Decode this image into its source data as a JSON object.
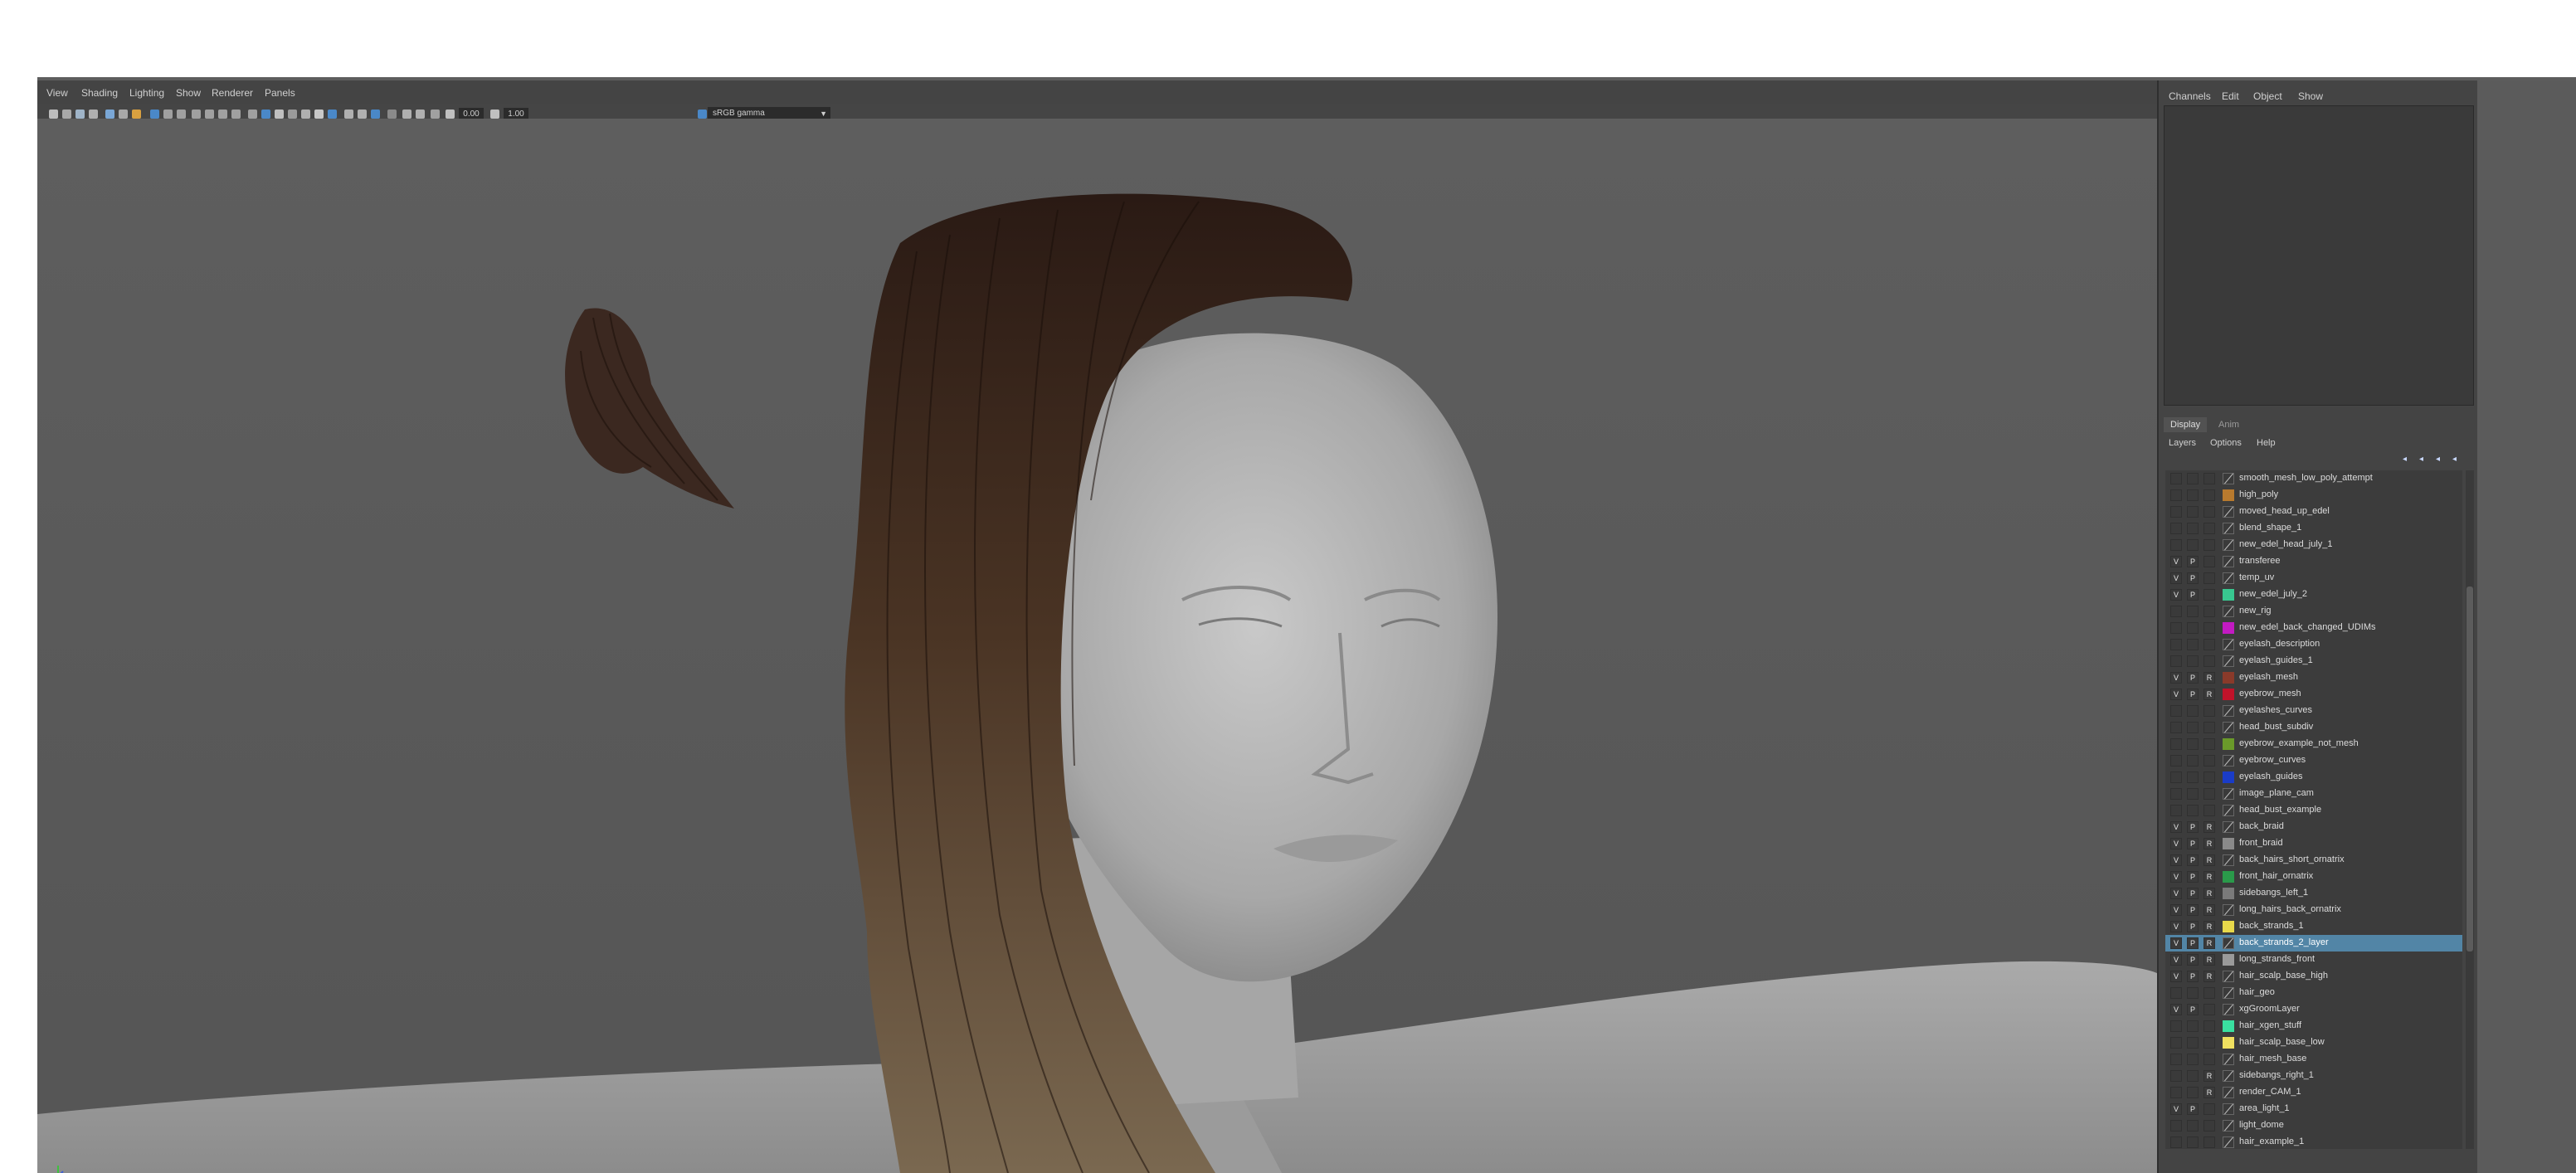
{
  "viewport": {
    "menu": [
      "View",
      "Shading",
      "Lighting",
      "Show",
      "Renderer",
      "Panels"
    ],
    "exposure": "0.00",
    "gamma": "1.00",
    "color_space": "sRGB gamma",
    "camera": "persp"
  },
  "channel_box": {
    "menu": [
      "Channels",
      "Edit",
      "Object",
      "Show"
    ]
  },
  "layer_editor": {
    "tabs": [
      "Display",
      "Anim"
    ],
    "active_tab": "Display",
    "menu": [
      "Layers",
      "Options",
      "Help"
    ],
    "selected_index": 28,
    "layers": [
      {
        "v": "",
        "p": "",
        "r": "",
        "color": null,
        "name": "smooth_mesh_low_poly_attempt"
      },
      {
        "v": "",
        "p": "",
        "r": "",
        "color": "#b87a2e",
        "name": "high_poly"
      },
      {
        "v": "",
        "p": "",
        "r": "",
        "color": null,
        "name": "moved_head_up_edel"
      },
      {
        "v": "",
        "p": "",
        "r": "",
        "color": null,
        "name": "blend_shape_1"
      },
      {
        "v": "",
        "p": "",
        "r": "",
        "color": null,
        "name": "new_edel_head_july_1"
      },
      {
        "v": "V",
        "p": "P",
        "r": "",
        "color": null,
        "name": "transferee"
      },
      {
        "v": "V",
        "p": "P",
        "r": "",
        "color": null,
        "name": "temp_uv"
      },
      {
        "v": "V",
        "p": "P",
        "r": "",
        "color": "#38c890",
        "name": "new_edel_july_2"
      },
      {
        "v": "",
        "p": "",
        "r": "",
        "color": null,
        "name": "new_rig"
      },
      {
        "v": "",
        "p": "",
        "r": "",
        "color": "#c31ac3",
        "name": "new_edel_back_changed_UDIMs"
      },
      {
        "v": "",
        "p": "",
        "r": "",
        "color": null,
        "name": "eyelash_description"
      },
      {
        "v": "",
        "p": "",
        "r": "",
        "color": null,
        "name": "eyelash_guides_1"
      },
      {
        "v": "V",
        "p": "P",
        "r": "R",
        "color": "#8a3a2a",
        "name": "eyelash_mesh"
      },
      {
        "v": "V",
        "p": "P",
        "r": "R",
        "color": "#c0132a",
        "name": "eyebrow_mesh"
      },
      {
        "v": "",
        "p": "",
        "r": "",
        "color": null,
        "name": "eyelashes_curves"
      },
      {
        "v": "",
        "p": "",
        "r": "",
        "color": null,
        "name": "head_bust_subdiv"
      },
      {
        "v": "",
        "p": "",
        "r": "",
        "color": "#6a9a2a",
        "name": "eyebrow_example_not_mesh"
      },
      {
        "v": "",
        "p": "",
        "r": "",
        "color": null,
        "name": "eyebrow_curves"
      },
      {
        "v": "",
        "p": "",
        "r": "",
        "color": "#1a3cc8",
        "name": "eyelash_guides"
      },
      {
        "v": "",
        "p": "",
        "r": "",
        "color": null,
        "name": "image_plane_cam"
      },
      {
        "v": "",
        "p": "",
        "r": "",
        "color": null,
        "name": "head_bust_example"
      },
      {
        "v": "V",
        "p": "P",
        "r": "R",
        "color": null,
        "name": "back_braid"
      },
      {
        "v": "V",
        "p": "P",
        "r": "R",
        "color": "#8a8a8a",
        "name": "front_braid"
      },
      {
        "v": "V",
        "p": "P",
        "r": "R",
        "color": null,
        "name": "back_hairs_short_ornatrix"
      },
      {
        "v": "V",
        "p": "P",
        "r": "R",
        "color": "#2a9a4a",
        "name": "front_hair_ornatrix"
      },
      {
        "v": "V",
        "p": "P",
        "r": "R",
        "color": "#7a7a7a",
        "name": "sidebangs_left_1"
      },
      {
        "v": "V",
        "p": "P",
        "r": "R",
        "color": null,
        "name": "long_hairs_back_ornatrix"
      },
      {
        "v": "V",
        "p": "P",
        "r": "R",
        "color": "#e8d84a",
        "name": "back_strands_1"
      },
      {
        "v": "V",
        "p": "P",
        "r": "R",
        "color": null,
        "name": "back_strands_2_layer"
      },
      {
        "v": "V",
        "p": "P",
        "r": "R",
        "color": "#9a9a9a",
        "name": "long_strands_front"
      },
      {
        "v": "V",
        "p": "P",
        "r": "R",
        "color": null,
        "name": "hair_scalp_base_high"
      },
      {
        "v": "",
        "p": "",
        "r": "",
        "color": null,
        "name": "hair_geo"
      },
      {
        "v": "V",
        "p": "P",
        "r": "",
        "color": null,
        "name": "xgGroomLayer"
      },
      {
        "v": "",
        "p": "",
        "r": "",
        "color": "#3ae0a0",
        "name": "hair_xgen_stuff"
      },
      {
        "v": "",
        "p": "",
        "r": "",
        "color": "#f0e060",
        "name": "hair_scalp_base_low"
      },
      {
        "v": "",
        "p": "",
        "r": "",
        "color": null,
        "name": "hair_mesh_base"
      },
      {
        "v": "",
        "p": "",
        "r": "R",
        "color": null,
        "name": "sidebangs_right_1"
      },
      {
        "v": "",
        "p": "",
        "r": "R",
        "color": null,
        "name": "render_CAM_1"
      },
      {
        "v": "V",
        "p": "P",
        "r": "",
        "color": null,
        "name": "area_light_1"
      },
      {
        "v": "",
        "p": "",
        "r": "",
        "color": null,
        "name": "light_dome"
      },
      {
        "v": "",
        "p": "",
        "r": "",
        "color": null,
        "name": "hair_example_1"
      }
    ]
  }
}
